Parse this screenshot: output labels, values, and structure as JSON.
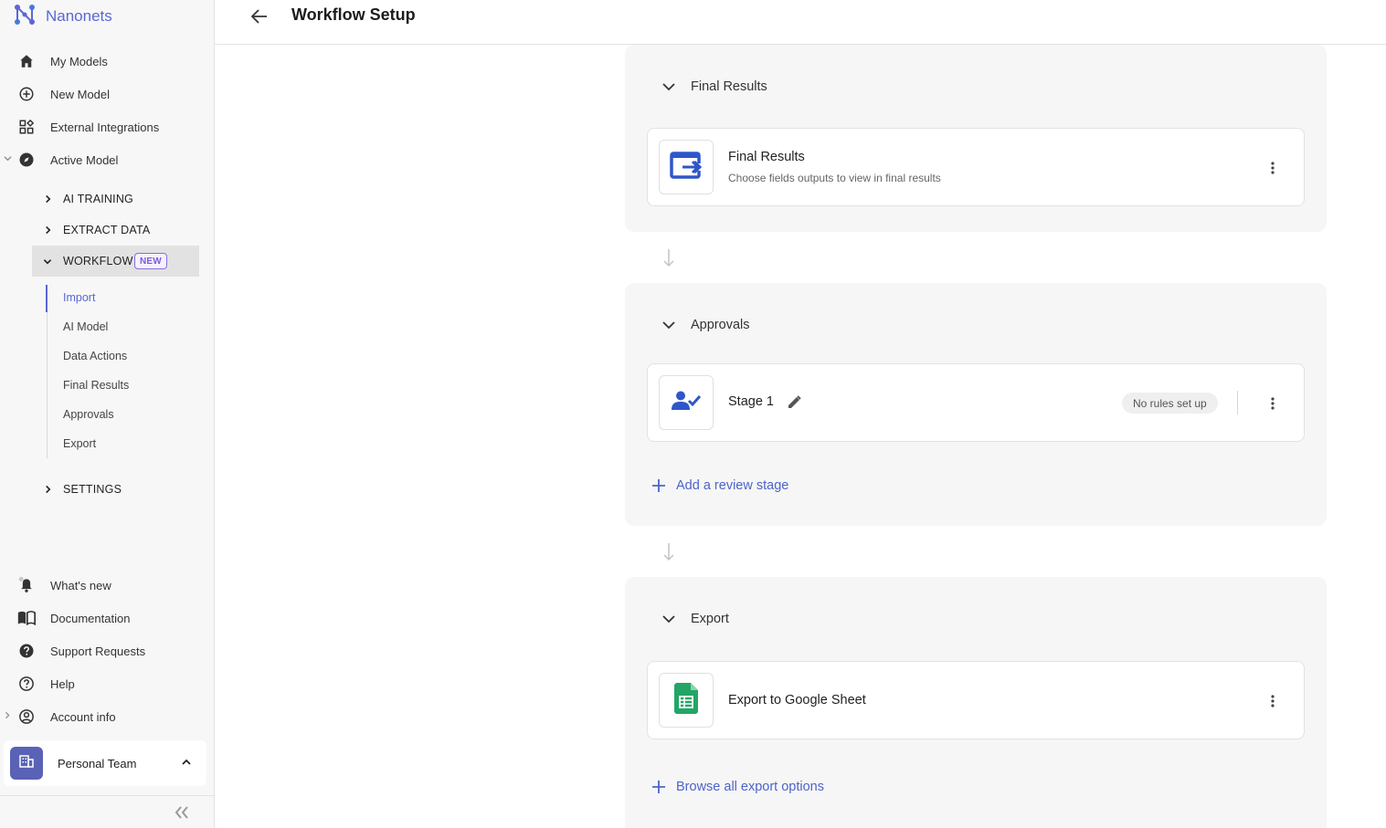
{
  "brand": {
    "name": "Nanonets"
  },
  "sidebar": {
    "main_items": [
      {
        "label": "My Models",
        "icon": "home-icon"
      },
      {
        "label": "New Model",
        "icon": "plus-circle-icon"
      },
      {
        "label": "External Integrations",
        "icon": "apps-grid-icon"
      },
      {
        "label": "Active Model",
        "icon": "compass-icon"
      }
    ],
    "sections": [
      {
        "label": "AI TRAINING"
      },
      {
        "label": "EXTRACT DATA"
      },
      {
        "label": "WORKFLOW",
        "badge": "NEW"
      },
      {
        "label": "SETTINGS"
      }
    ],
    "workflow_steps": [
      {
        "label": "Import"
      },
      {
        "label": "AI Model"
      },
      {
        "label": "Data Actions"
      },
      {
        "label": "Final Results"
      },
      {
        "label": "Approvals"
      },
      {
        "label": "Export"
      }
    ],
    "bottom_items": [
      {
        "label": "What's new",
        "icon": "bell-icon"
      },
      {
        "label": "Documentation",
        "icon": "book-icon"
      },
      {
        "label": "Support Requests",
        "icon": "help-filled-icon"
      },
      {
        "label": "Help",
        "icon": "help-outline-icon"
      },
      {
        "label": "Account info",
        "icon": "account-circle-icon"
      }
    ],
    "team": {
      "name": "Personal Team"
    }
  },
  "header": {
    "title": "Workflow Setup"
  },
  "panels": {
    "final_results": {
      "heading": "Final Results",
      "card_title": "Final Results",
      "card_subtitle": "Choose fields outputs to view in final results"
    },
    "approvals": {
      "heading": "Approvals",
      "stage_title": "Stage 1",
      "rules_status": "No rules set up",
      "add_label": "Add a review stage"
    },
    "export": {
      "heading": "Export",
      "card_title": "Export to Google Sheet",
      "add_label": "Browse all export options"
    }
  },
  "colors": {
    "accent": "#5968d6",
    "link": "#4d64c9",
    "icon_blue": "#2f56c9",
    "sheets_green": "#23a566",
    "panel_bg": "#f6f6f6",
    "sidebar_bg": "#f7f7f7"
  }
}
